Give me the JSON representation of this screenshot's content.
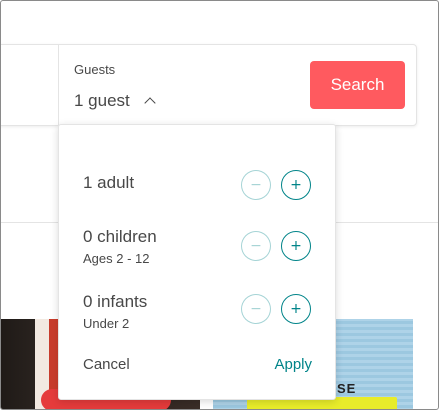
{
  "search_bar": {
    "guests_label": "Guests",
    "guests_value": "1 guest",
    "search_button_label": "Search",
    "accent_color": "#ff5a5f"
  },
  "popover": {
    "rows": [
      {
        "label": "1 adult",
        "sub": ""
      },
      {
        "label": "0 children",
        "sub": "Ages 2 - 12"
      },
      {
        "label": "0 infants",
        "sub": "Under 2"
      }
    ],
    "minus_icon": "minus-icon",
    "plus_icon": "plus-icon",
    "cancel_label": "Cancel",
    "apply_label": "Apply",
    "teal_color": "#008489"
  },
  "listing_images": {
    "right_text": "SE"
  }
}
